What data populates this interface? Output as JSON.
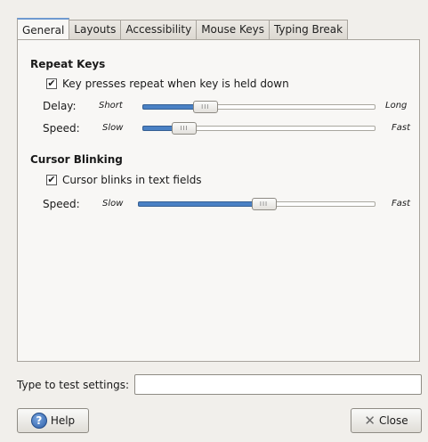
{
  "tabs": [
    "General",
    "Layouts",
    "Accessibility",
    "Mouse Keys",
    "Typing Break"
  ],
  "repeat_keys": {
    "title": "Repeat Keys",
    "checkbox_label": "Key presses repeat when key is held down",
    "checked": true,
    "delay": {
      "label": "Delay:",
      "min": "Short",
      "max": "Long",
      "value": 0.27
    },
    "speed": {
      "label": "Speed:",
      "min": "Slow",
      "max": "Fast",
      "value": 0.18
    }
  },
  "cursor_blinking": {
    "title": "Cursor Blinking",
    "checkbox_label": "Cursor blinks in text fields",
    "checked": true,
    "speed": {
      "label": "Speed:",
      "min": "Slow",
      "max": "Fast",
      "value": 0.53
    }
  },
  "test": {
    "label": "Type to test settings:",
    "value": ""
  },
  "buttons": {
    "help": "Help",
    "close": "Close"
  },
  "colors": {
    "accent": "#4a81c4",
    "tab_highlight": "#6f9ad0"
  }
}
